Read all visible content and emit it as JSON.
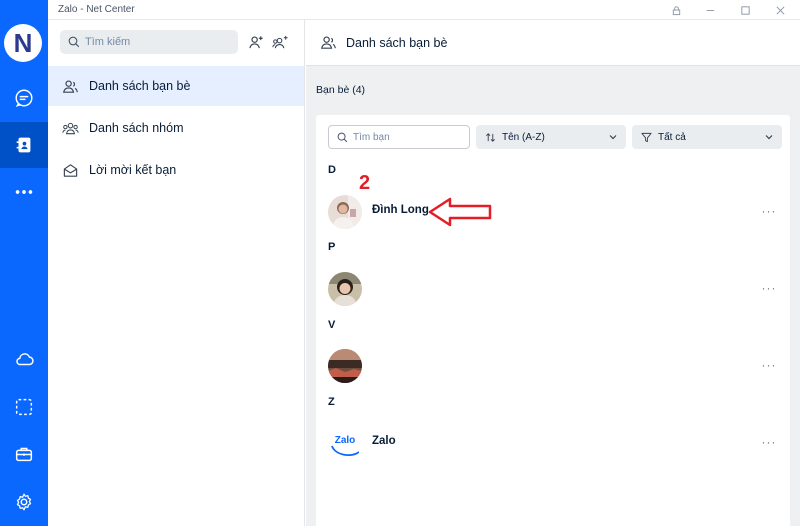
{
  "window": {
    "title": "Zalo - Net Center"
  },
  "rail": {
    "logo_letter": "N",
    "items": [
      {
        "icon": "message-icon"
      },
      {
        "icon": "contacts-icon",
        "active": true
      },
      {
        "icon": "more-icon"
      },
      {
        "icon": "cloud-icon"
      },
      {
        "icon": "screenshot-icon"
      },
      {
        "icon": "briefcase-icon"
      },
      {
        "icon": "settings-icon"
      }
    ]
  },
  "sidebar": {
    "search_placeholder": "Tìm kiếm",
    "items": [
      {
        "label": "Danh sách bạn bè",
        "icon": "friends-icon",
        "active": true
      },
      {
        "label": "Danh sách nhóm",
        "icon": "group-icon"
      },
      {
        "label": "Lời mời kết bạn",
        "icon": "envelope-icon"
      }
    ]
  },
  "main": {
    "header_title": "Danh sách bạn bè",
    "count_label": "Bạn bè (4)",
    "filter": {
      "search_placeholder": "Tìm bạn",
      "sort_label": "Tên (A-Z)",
      "filter_label": "Tất cả"
    },
    "groups": [
      {
        "letter": "D",
        "friends": [
          {
            "name": "Đình Long"
          }
        ]
      },
      {
        "letter": "P",
        "friends": [
          {
            "name": ""
          }
        ]
      },
      {
        "letter": "V",
        "friends": [
          {
            "name": ""
          }
        ]
      },
      {
        "letter": "Z",
        "friends": [
          {
            "name": "Zalo"
          }
        ]
      }
    ],
    "more_glyph": "···"
  },
  "annotation": {
    "number": "2"
  },
  "colors": {
    "brand": "#0a68ff",
    "active_bg": "#e5efff",
    "annotation": "#e41e26"
  }
}
